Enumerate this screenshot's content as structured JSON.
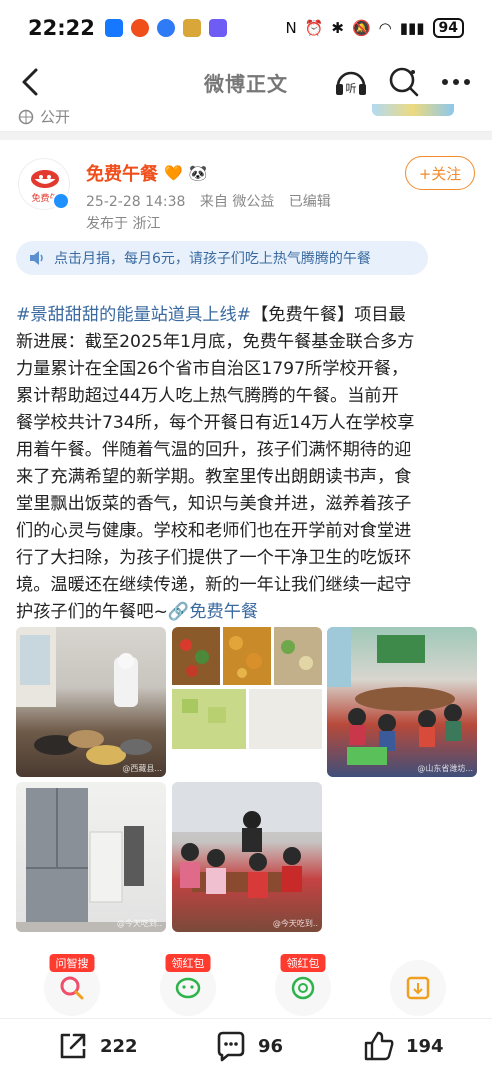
{
  "status_bar": {
    "time": "22:22",
    "battery": "94"
  },
  "nav": {
    "title": "微博正文",
    "listen_label": "听"
  },
  "prev_post": {
    "visibility": "公开"
  },
  "post": {
    "author": "免费午餐",
    "avatar_text": "免费午",
    "date": "25-2-28 14:38",
    "source": "来自 微公益",
    "edited": "已编辑",
    "location": "发布于 浙江",
    "follow_label": "+关注",
    "donate_banner": "点击月捐，每月6元，请孩子们吃上热气腾腾的午餐",
    "lines": [
      {
        "hl": "#景甜甜甜的能量站道具上线#",
        "text": "【免费午餐】项目最"
      },
      {
        "hl": "",
        "text": "新进展：截至2025年1月底，免费午餐基金联合多方"
      },
      {
        "hl": "",
        "text": "力量累计在全国26个省市自治区1797所学校开餐，"
      },
      {
        "hl": "",
        "text": "累计帮助超过44万人吃上热气腾腾的午餐。当前开"
      },
      {
        "hl": "",
        "text": "餐学校共计734所，每个开餐日有近14万人在学校享"
      },
      {
        "hl": "",
        "text": "用着午餐。伴随着气温的回升，孩子们满怀期待的迎"
      },
      {
        "hl": "",
        "text": "来了充满希望的新学期。教室里传出朗朗读书声，食"
      },
      {
        "hl": "",
        "text": "堂里飘出饭菜的香气，知识与美食并进，滋养着孩子"
      },
      {
        "hl": "",
        "text": "们的心灵与健康。学校和老师们也在开学前对食堂进"
      },
      {
        "hl": "",
        "text": "行了大扫除，为孩子们提供了一个干净卫生的吃饭环"
      },
      {
        "hl": "",
        "text": "境。温暖还在继续传递，新的一年让我们继续一起守"
      }
    ],
    "last_line_text": "护孩子们的午餐吧~",
    "last_line_link": "免费午餐",
    "watermarks": [
      "@西藏县...",
      "@山东省潍坊...",
      "@今天吃到..",
      "@今天吃到.."
    ]
  },
  "actions": {
    "ask_badge": "问智搜",
    "share_badge": "领红包",
    "share2_badge": "领红包"
  },
  "bottom_bar": {
    "repost_count": "222",
    "comment_count": "96",
    "like_count": "194"
  },
  "colors": {
    "accent": "#f28b2d",
    "link": "#3a6aa0",
    "author": "#f04e1a"
  }
}
